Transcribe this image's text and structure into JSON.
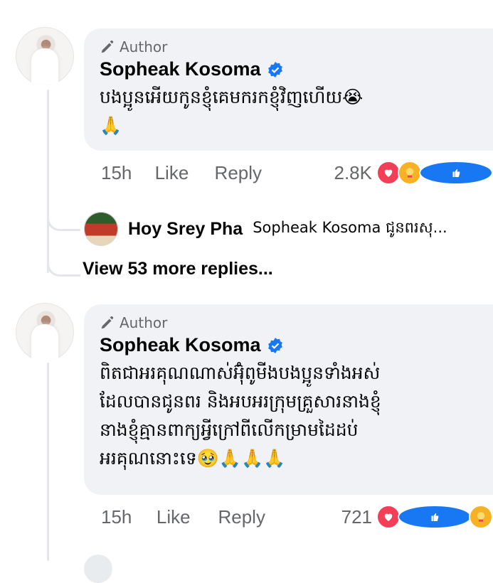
{
  "colors": {
    "bubble": "#f0f2f5",
    "meta_text": "#65676b",
    "verified": "#1877f2",
    "thread_line": "#e4e6eb"
  },
  "comments": [
    {
      "author_label": "Author",
      "name": "Sopheak Kosoma",
      "verified": true,
      "text": "បងប្អូនអើយកូនខ្ញុំគេមករកខ្ញុំវិញហើយ😭\n🙏",
      "time": "15h",
      "like_label": "Like",
      "reply_label": "Reply",
      "reaction_count": "2.8K",
      "reactions": [
        "love-icon",
        "care-icon",
        "like-icon"
      ]
    },
    {
      "author_label": "Author",
      "name": "Sopheak Kosoma",
      "verified": true,
      "text": "ពិតជាអរគុណណាស់អ៊ុំពូមីងបងប្អូនទាំងអស់\nដែលបានជូនពរ និងអបអរក្រុមគ្រួសារនាងខ្ញុំ\nនាងខ្ញុំគ្មានពាក្យអ្វីក្រៅពីលើកម្រាមដៃដប់\nអរគុណនោះទេ🥹🙏🙏🙏",
      "time": "15h",
      "like_label": "Like",
      "reply_label": "Reply",
      "reaction_count": "721",
      "reactions": [
        "love-icon",
        "like-icon",
        "care-icon"
      ]
    }
  ],
  "reply_preview": {
    "name": "Hoy Srey Pha",
    "snippet": "Sopheak Kosoma ជូនពរសុ..."
  },
  "view_more_label": "View 53 more replies..."
}
